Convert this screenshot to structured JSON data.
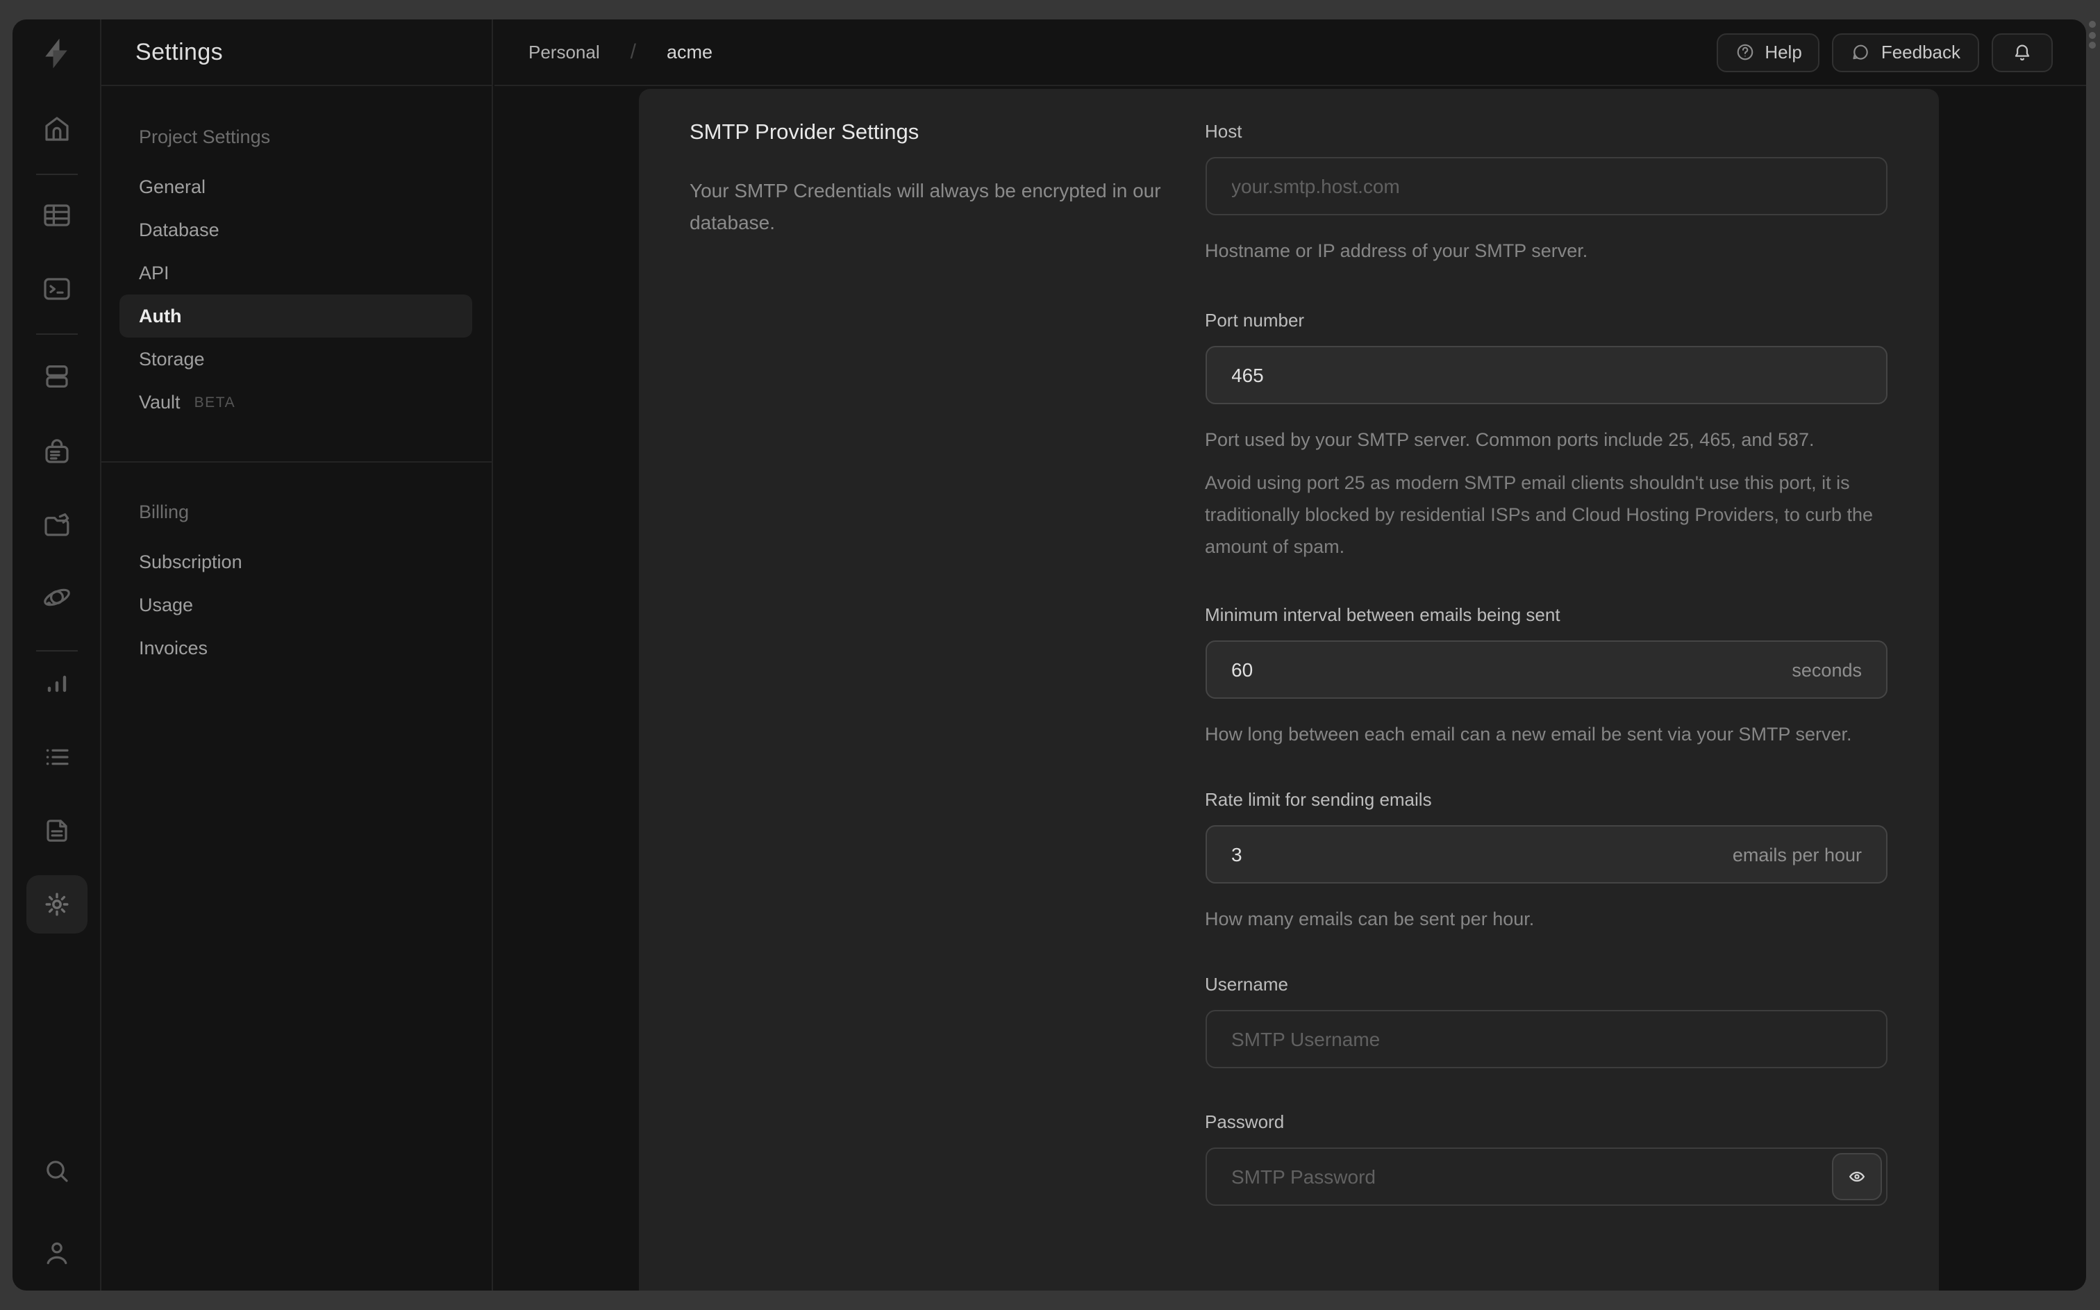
{
  "header": {
    "app_title": "Settings",
    "breadcrumb": {
      "org": "Personal",
      "separator": "/",
      "project": "acme"
    },
    "actions": {
      "help": "Help",
      "feedback": "Feedback"
    }
  },
  "rail": {
    "icons": [
      "supabase-logo",
      "home-icon",
      "table-editor-icon",
      "sql-editor-icon",
      "database-icon",
      "auth-lock-icon",
      "storage-icon",
      "edge-functions-icon",
      "reports-icon",
      "logs-icon",
      "docs-icon",
      "settings-gear-icon",
      "search-icon",
      "user-icon"
    ],
    "active": "settings-gear-icon"
  },
  "sidebar": {
    "sections": [
      {
        "heading": "Project Settings",
        "items": [
          {
            "label": "General"
          },
          {
            "label": "Database"
          },
          {
            "label": "API"
          },
          {
            "label": "Auth",
            "active": true
          },
          {
            "label": "Storage"
          },
          {
            "label": "Vault",
            "badge": "BETA"
          }
        ]
      },
      {
        "heading": "Billing",
        "items": [
          {
            "label": "Subscription"
          },
          {
            "label": "Usage"
          },
          {
            "label": "Invoices"
          }
        ]
      }
    ]
  },
  "content": {
    "section": {
      "title": "SMTP Provider Settings",
      "description": "Your SMTP Credentials will always be encrypted in our database."
    },
    "fields": {
      "host": {
        "label": "Host",
        "placeholder": "your.smtp.host.com",
        "helper": "Hostname or IP address of your SMTP server."
      },
      "port": {
        "label": "Port number",
        "value": "465",
        "helper": "Port used by your SMTP server. Common ports include 25, 465, and 587.",
        "note": "Avoid using port 25 as modern SMTP email clients shouldn't use this port, it is traditionally blocked by residential ISPs and Cloud Hosting Providers, to curb the amount of spam."
      },
      "interval": {
        "label": "Minimum interval between emails being sent",
        "value": "60",
        "suffix": "seconds",
        "helper": "How long between each email can a new email be sent via your SMTP server."
      },
      "rate": {
        "label": "Rate limit for sending emails",
        "value": "3",
        "suffix": "emails per hour",
        "helper": "How many emails can be sent per hour."
      },
      "username": {
        "label": "Username",
        "placeholder": "SMTP Username"
      },
      "password": {
        "label": "Password",
        "placeholder": "SMTP Password"
      }
    }
  },
  "colors": {
    "frame": "#373737",
    "window_bg": "#131313",
    "panel_bg": "#232323",
    "input_bg": "#242424",
    "input_filled_bg": "#2c2c2c",
    "border": "#3d3d3d",
    "text_bright": "#e9e9e9",
    "text_muted": "#8b8b8b",
    "active_item_bg": "#212121"
  }
}
